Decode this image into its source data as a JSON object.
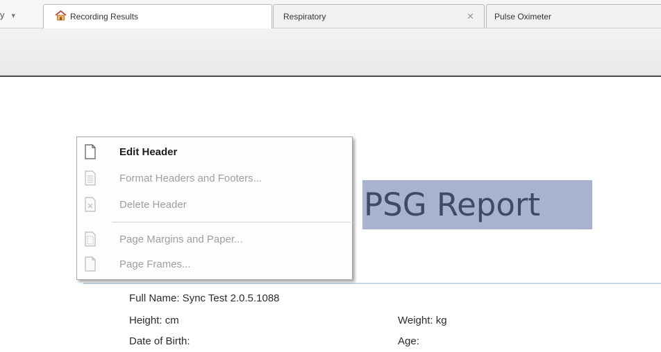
{
  "tabs": {
    "overflow_label": "y",
    "overflow_dropdown": "▾",
    "items": [
      {
        "label": "Recording Results",
        "icon": "home-icon"
      },
      {
        "label": "Respiratory",
        "close": "✕"
      },
      {
        "label": "Pulse Oximeter"
      }
    ]
  },
  "report": {
    "title": "PSG Report",
    "full_name": "Full Name: Sync Test 2.0.5.1088",
    "height": "Height:  cm",
    "weight": "Weight:  kg",
    "dob": "Date of Birth:",
    "age": "Age:"
  },
  "context_menu": {
    "items": [
      {
        "label": "Edit Header",
        "enabled": true,
        "icon": "document-icon"
      },
      {
        "label": "Format Headers and Footers...",
        "enabled": false,
        "icon": "format-header-icon"
      },
      {
        "label": "Delete Header",
        "enabled": false,
        "icon": "delete-header-icon"
      },
      {
        "label": "Page Margins and Paper...",
        "enabled": false,
        "icon": "page-margins-icon"
      },
      {
        "label": "Page Frames...",
        "enabled": false,
        "icon": "page-frames-icon"
      }
    ]
  },
  "colors": {
    "title_highlight": "#a8b4ce",
    "title_text": "#3c4b66",
    "disabled_text": "#9e9e9e"
  }
}
